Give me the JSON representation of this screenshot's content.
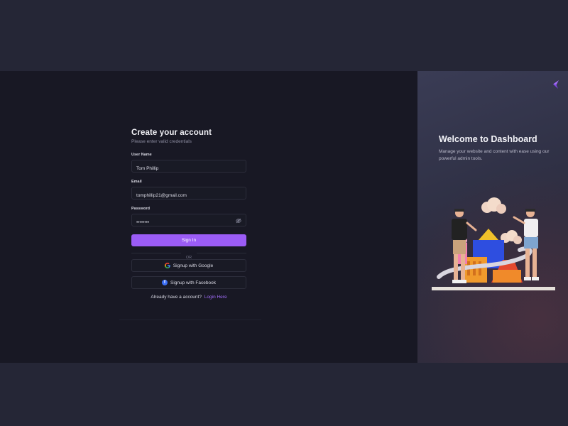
{
  "form": {
    "title": "Create your account",
    "subtitle": "Please enter valid credentials",
    "username_label": "User Name",
    "username_value": "Tom Phillip",
    "email_label": "Email",
    "email_value": "tomphillip21@gmail.com",
    "password_label": "Password",
    "password_value": "password",
    "signin_label": "Sign In",
    "or_text": "OR",
    "google_label": "Signup with Google",
    "facebook_label": "Signup with Facebook",
    "facebook_glyph": "f",
    "account_text": "Already have a account?",
    "login_link": "Login Here"
  },
  "hero": {
    "title": "Welcome to Dashboard",
    "description": "Manage your website and content with ease using our powerful admin tools."
  },
  "icons": {
    "brand_logo": "brand-logo-icon",
    "password_toggle": "eye-off-icon",
    "google": "google-icon",
    "facebook": "facebook-icon"
  },
  "colors": {
    "accent": "#9b5cf6",
    "link": "#a06cf7",
    "left_panel": "#181824",
    "page_background": "#252636"
  }
}
